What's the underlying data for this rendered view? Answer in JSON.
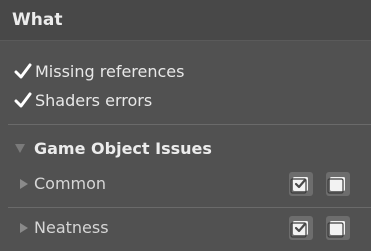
{
  "header": {
    "title": "What"
  },
  "checks": [
    {
      "label": "Missing references",
      "checked": true
    },
    {
      "label": "Shaders errors",
      "checked": true
    }
  ],
  "group": {
    "title": "Game Object Issues",
    "expanded": true,
    "items": [
      {
        "label": "Common"
      },
      {
        "label": "Neatness"
      }
    ]
  },
  "colors": {
    "background": "#515151",
    "header_bg": "#484848",
    "button_bg": "#6d6d6d",
    "text": "#e4e4e4"
  }
}
